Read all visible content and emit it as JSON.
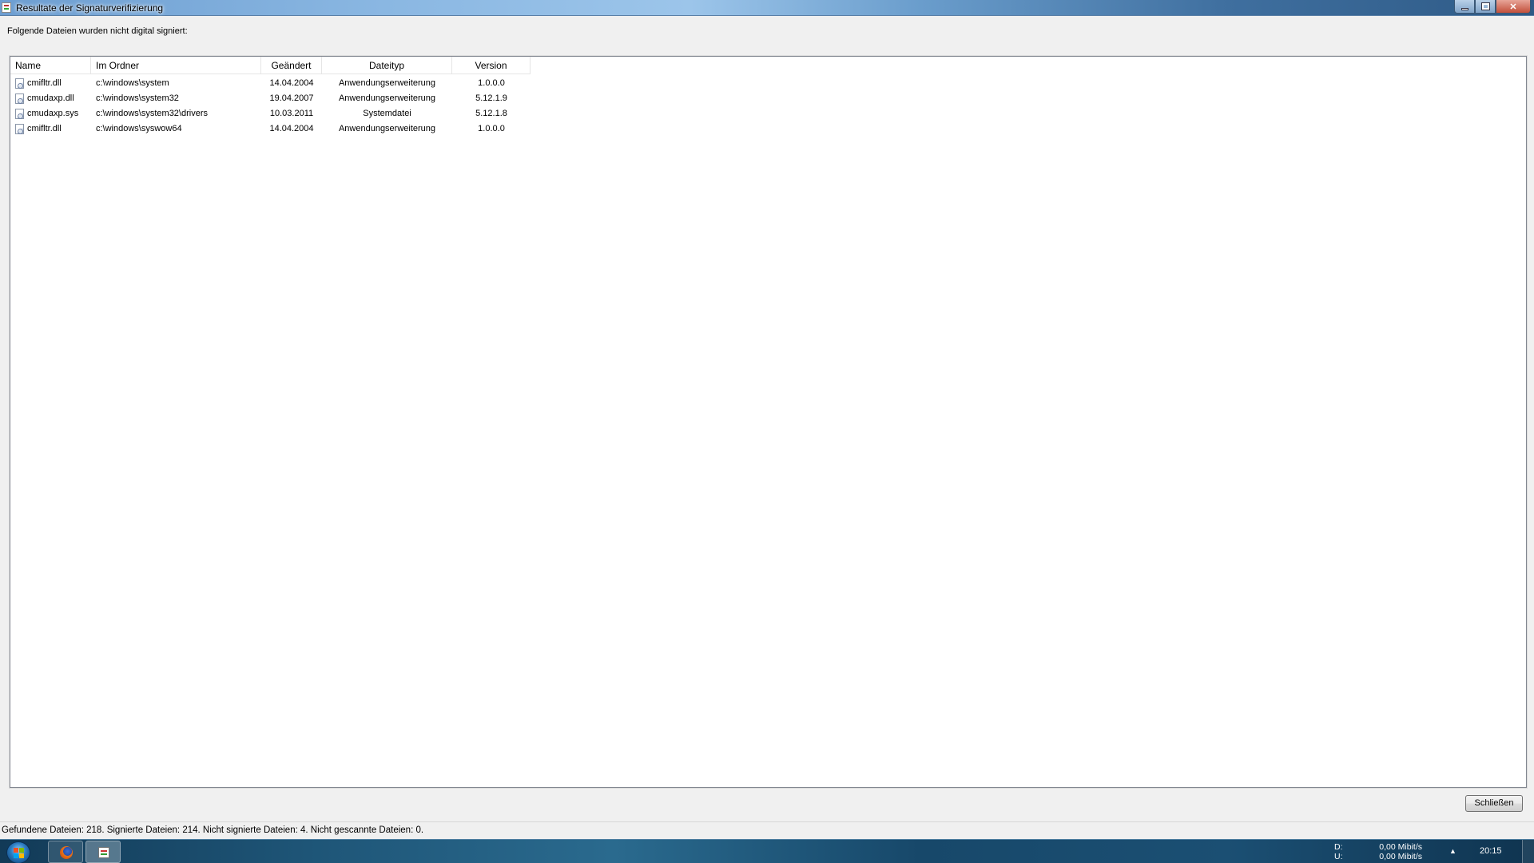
{
  "window": {
    "title": "Resultate der Signaturverifizierung"
  },
  "intro_text": "Folgende Dateien wurden nicht digital signiert:",
  "list": {
    "columns": [
      "Name",
      "Im Ordner",
      "Geändert",
      "Dateityp",
      "Version"
    ],
    "rows": [
      {
        "name": "cmifltr.dll",
        "folder": "c:\\windows\\system",
        "date": "14.04.2004",
        "type": "Anwendungserweiterung",
        "version": "1.0.0.0"
      },
      {
        "name": "cmudaxp.dll",
        "folder": "c:\\windows\\system32",
        "date": "19.04.2007",
        "type": "Anwendungserweiterung",
        "version": "5.12.1.9"
      },
      {
        "name": "cmudaxp.sys",
        "folder": "c:\\windows\\system32\\drivers",
        "date": "10.03.2011",
        "type": "Systemdatei",
        "version": "5.12.1.8"
      },
      {
        "name": "cmifltr.dll",
        "folder": "c:\\windows\\syswow64",
        "date": "14.04.2004",
        "type": "Anwendungserweiterung",
        "version": "1.0.0.0"
      }
    ]
  },
  "close_button": "Schließen",
  "status_text": "Gefundene Dateien: 218.  Signierte Dateien: 214. Nicht signierte Dateien: 4. Nicht gescannte Dateien: 0.",
  "taskbar": {
    "net_down_label": "D:",
    "net_down_value": "0,00 Mibit/s",
    "net_up_label": "U:",
    "net_up_value": "0,00 Mibit/s",
    "clock": "20:15",
    "tray_arrow": "▲"
  }
}
